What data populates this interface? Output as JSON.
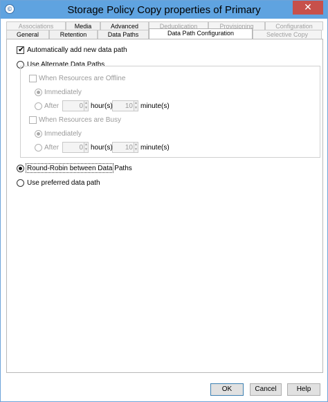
{
  "window": {
    "title": "Storage Policy Copy properties of Primary",
    "close_glyph": "✕",
    "app_icon_glyph": "©"
  },
  "tabs_top": [
    {
      "label": "Associations",
      "disabled": true
    },
    {
      "label": "Media",
      "disabled": false
    },
    {
      "label": "Advanced",
      "disabled": false
    },
    {
      "label": "Deduplication",
      "disabled": true
    },
    {
      "label": "Provisioning",
      "disabled": true
    },
    {
      "label": "Configuration",
      "disabled": true
    }
  ],
  "tabs_bottom": [
    {
      "label": "General",
      "disabled": false
    },
    {
      "label": "Retention",
      "disabled": false
    },
    {
      "label": "Data Paths",
      "disabled": false
    },
    {
      "label": "Data Path Configuration",
      "disabled": false,
      "active": true
    },
    {
      "label": "Selective Copy",
      "disabled": true
    }
  ],
  "options": {
    "auto_add_label": "Automatically add new data path",
    "use_alternate_label": "Use Alternate Data Paths",
    "offline_label": "When Resources are Offline",
    "offline_immediately": "Immediately",
    "offline_after": "After",
    "offline_hours": "0",
    "offline_hours_unit": "hour(s)",
    "offline_minutes": "10",
    "offline_minutes_unit": "minute(s)",
    "busy_label": "When Resources are Busy",
    "busy_immediately": "Immediately",
    "busy_after": "After",
    "busy_hours": "0",
    "busy_hours_unit": "hour(s)",
    "busy_minutes": "10",
    "busy_minutes_unit": "minute(s)",
    "round_robin_label": "Round-Robin between Data Paths",
    "preferred_label": "Use preferred data path"
  },
  "buttons": {
    "ok": "OK",
    "cancel": "Cancel",
    "help": "Help"
  },
  "colors": {
    "titlebar": "#5fa3e0",
    "close": "#c7504b"
  }
}
